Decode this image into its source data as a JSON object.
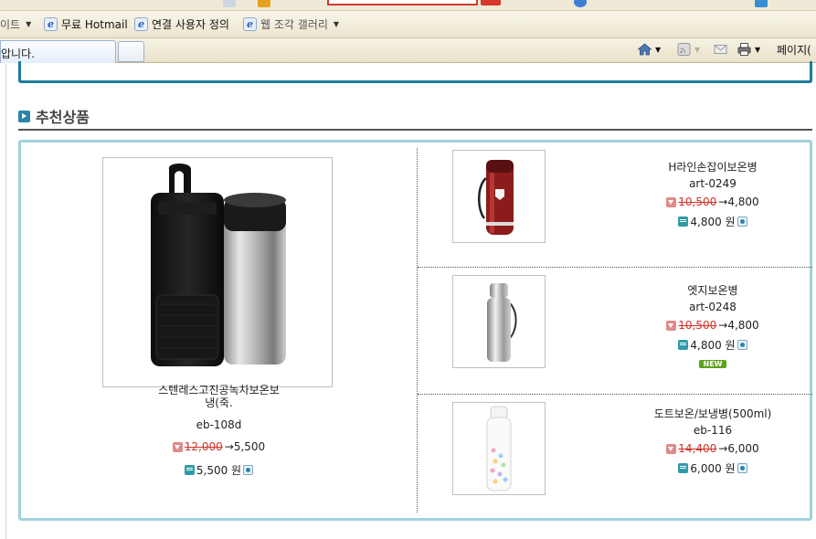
{
  "favorites_bar": {
    "items": [
      {
        "label": "이트",
        "dropdown": true
      },
      {
        "label": "무료 Hotmail"
      },
      {
        "label": "연결 사용자 정의"
      },
      {
        "label": "웹 조각 갤러리",
        "dropdown": true
      }
    ]
  },
  "tab": {
    "title": "압니다."
  },
  "command_bar": {
    "page_label": "페이지("
  },
  "section": {
    "title": "추천상품"
  },
  "featured": {
    "name": "스텐레스고진공녹차보온보냉(죽.",
    "name_line1": "스텐레스고진공녹차보온보",
    "name_line2": "냉(죽.",
    "code": "eb-108d",
    "old_price": "12,000",
    "new_price": "→5,500",
    "final_price": "5,500 원"
  },
  "side_products": [
    {
      "name": "H라인손잡이보온병",
      "code": "art-0249",
      "old_price": "10,500",
      "new_price": "→4,800",
      "final_price": "4,800 원",
      "badge": ""
    },
    {
      "name": "엣지보온병",
      "code": "art-0248",
      "old_price": "10,500",
      "new_price": "→4,800",
      "final_price": "4,800 원",
      "badge": "NEW"
    },
    {
      "name": "도트보온/보냉병(500ml)",
      "code": "eb-116",
      "old_price": "14,400",
      "new_price": "→6,000",
      "final_price": "6,000 원",
      "badge": ""
    }
  ],
  "colors": {
    "accent": "#1d7c99",
    "box_border": "#9fd1dc",
    "old_price": "#d0332a",
    "new_badge": "#5ea21d"
  },
  "icons": [
    "ie-page-icon",
    "home-icon",
    "rss-feed-icon",
    "mail-icon",
    "print-icon",
    "section-bullet-icon",
    "price-down-icon",
    "won-icon",
    "cart-icon"
  ]
}
